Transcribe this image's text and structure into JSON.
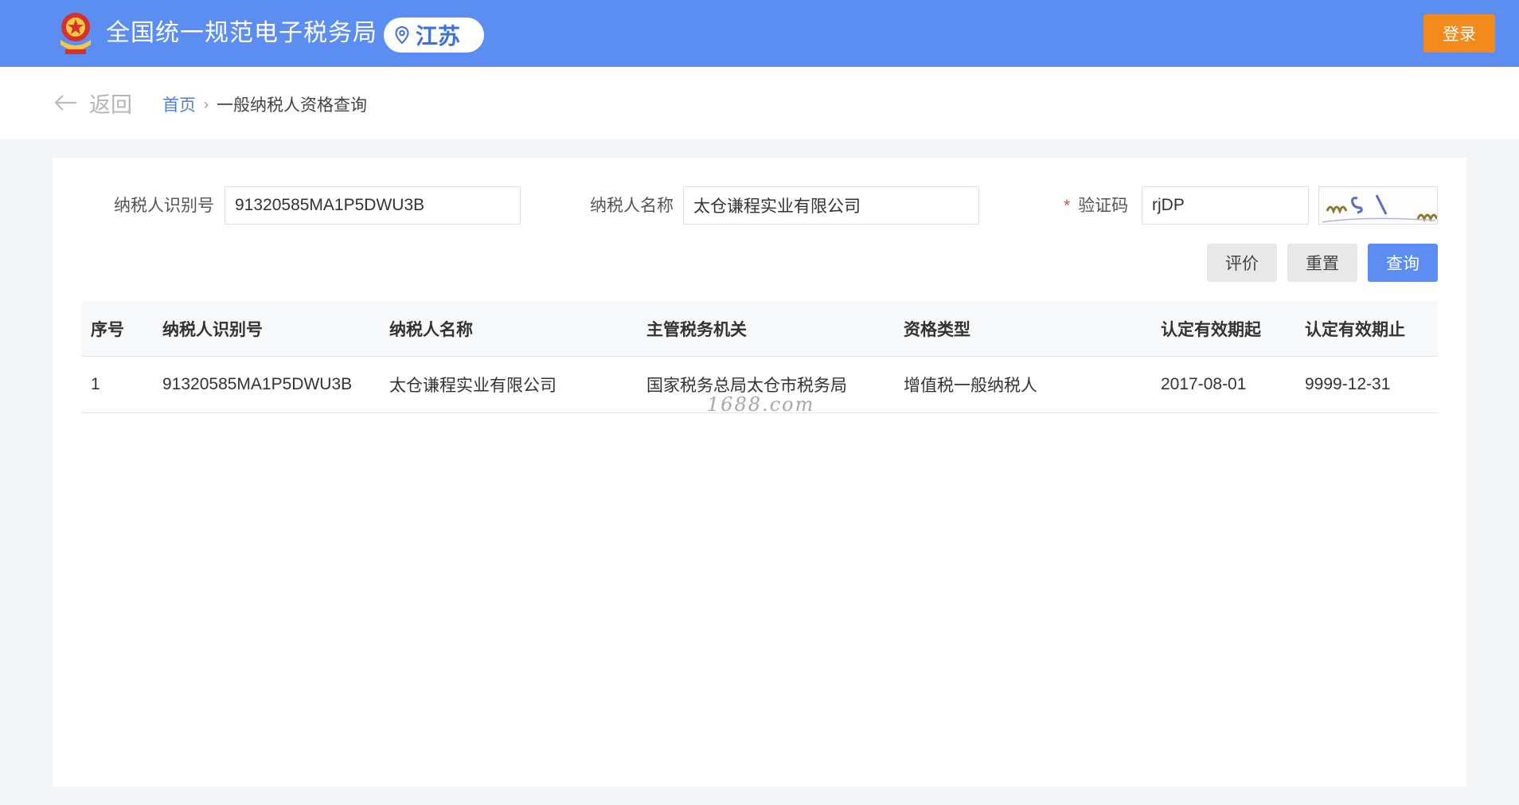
{
  "header": {
    "site_title": "全国统一规范电子税务局",
    "region": "江苏",
    "login_label": "登录"
  },
  "breadcrumb": {
    "back_label": "返回",
    "home_label": "首页",
    "separator": "›",
    "current_label": "一般纳税人资格查询"
  },
  "form": {
    "taxpayer_id_label": "纳税人识别号",
    "taxpayer_id_value": "91320585MA1P5DWU3B",
    "taxpayer_name_label": "纳税人名称",
    "taxpayer_name_value": "太仓谦程实业有限公司",
    "captcha_required_mark": "*",
    "captcha_label": "验证码",
    "captcha_value": "rjDP",
    "buttons": {
      "evaluate": "评价",
      "reset": "重置",
      "query": "查询"
    }
  },
  "table": {
    "columns": [
      "序号",
      "纳税人识别号",
      "纳税人名称",
      "主管税务机关",
      "资格类型",
      "认定有效期起",
      "认定有效期止"
    ],
    "rows": [
      [
        "1",
        "91320585MA1P5DWU3B",
        "太仓谦程实业有限公司",
        "国家税务总局太仓市税务局",
        "增值税一般纳税人",
        "2017-08-01",
        "9999-12-31"
      ]
    ]
  },
  "watermark": "1688.com",
  "colors": {
    "header_bg": "#5b8df2",
    "login_btn": "#f28a1c",
    "primary": "#5b8df2",
    "link": "#4a7fd8"
  }
}
